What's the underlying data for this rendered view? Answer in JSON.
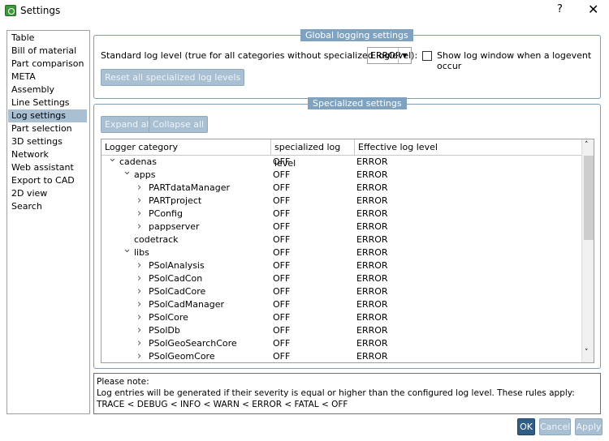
{
  "window": {
    "title": "Settings",
    "help": "?",
    "close": "✕"
  },
  "sidebar": {
    "items": [
      "Table",
      "Bill of material",
      "Part comparison",
      "META",
      "Assembly",
      "Line Settings",
      "Log settings",
      "Part selection",
      "3D settings",
      "Network",
      "Web assistant",
      "Export to CAD",
      "2D view",
      "Search"
    ],
    "selected": "Log settings"
  },
  "global": {
    "title": "Global logging settings",
    "standard_label": "Standard log level (true for all categories without specialized loglevel):",
    "level_value": "ERROR",
    "show_window_label": "Show log window when a logevent occur",
    "show_window_checked": false,
    "reset_button": "Reset all specialized log levels"
  },
  "specialized": {
    "title": "Specialized settings",
    "expand_all": "Expand all",
    "collapse_all": "Collapse all",
    "columns": [
      "Logger category",
      "specialized log level",
      "Effective log level"
    ],
    "rows": [
      {
        "name": "cadenas",
        "level": 0,
        "state": "expanded",
        "specialized": "OFF",
        "effective": "ERROR"
      },
      {
        "name": "apps",
        "level": 1,
        "state": "expanded",
        "specialized": "OFF",
        "effective": "ERROR"
      },
      {
        "name": "PARTdataManager",
        "level": 2,
        "state": "collapsed",
        "specialized": "OFF",
        "effective": "ERROR"
      },
      {
        "name": "PARTproject",
        "level": 2,
        "state": "collapsed",
        "specialized": "OFF",
        "effective": "ERROR"
      },
      {
        "name": "PConfig",
        "level": 2,
        "state": "collapsed",
        "specialized": "OFF",
        "effective": "ERROR"
      },
      {
        "name": "pappserver",
        "level": 2,
        "state": "collapsed",
        "specialized": "OFF",
        "effective": "ERROR"
      },
      {
        "name": "codetrack",
        "level": 1,
        "state": "leaf",
        "specialized": "OFF",
        "effective": "ERROR"
      },
      {
        "name": "libs",
        "level": 1,
        "state": "expanded",
        "specialized": "OFF",
        "effective": "ERROR"
      },
      {
        "name": "PSolAnalysis",
        "level": 2,
        "state": "collapsed",
        "specialized": "OFF",
        "effective": "ERROR"
      },
      {
        "name": "PSolCadCon",
        "level": 2,
        "state": "collapsed",
        "specialized": "OFF",
        "effective": "ERROR"
      },
      {
        "name": "PSolCadCore",
        "level": 2,
        "state": "collapsed",
        "specialized": "OFF",
        "effective": "ERROR"
      },
      {
        "name": "PSolCadManager",
        "level": 2,
        "state": "collapsed",
        "specialized": "OFF",
        "effective": "ERROR"
      },
      {
        "name": "PSolCore",
        "level": 2,
        "state": "collapsed",
        "specialized": "OFF",
        "effective": "ERROR"
      },
      {
        "name": "PSolDb",
        "level": 2,
        "state": "collapsed",
        "specialized": "OFF",
        "effective": "ERROR"
      },
      {
        "name": "PSolGeoSearchCore",
        "level": 2,
        "state": "collapsed",
        "specialized": "OFF",
        "effective": "ERROR"
      },
      {
        "name": "PSolGeomCore",
        "level": 2,
        "state": "collapsed",
        "specialized": "OFF",
        "effective": "ERROR"
      }
    ]
  },
  "note": {
    "line1": "Please note:",
    "line2": "Log entries will be generated if their severity is equal or higher than the configured log level. These rules apply:",
    "line3": "TRACE < DEBUG < INFO < WARN < ERROR < FATAL < OFF"
  },
  "buttons": {
    "ok": "OK",
    "cancel": "Cancel",
    "apply": "Apply"
  },
  "colors": {
    "accent": "#2f5f86",
    "group_label": "#7fa3bf",
    "disabled_button": "#a9c0d3",
    "selection": "#a9bfd2"
  }
}
